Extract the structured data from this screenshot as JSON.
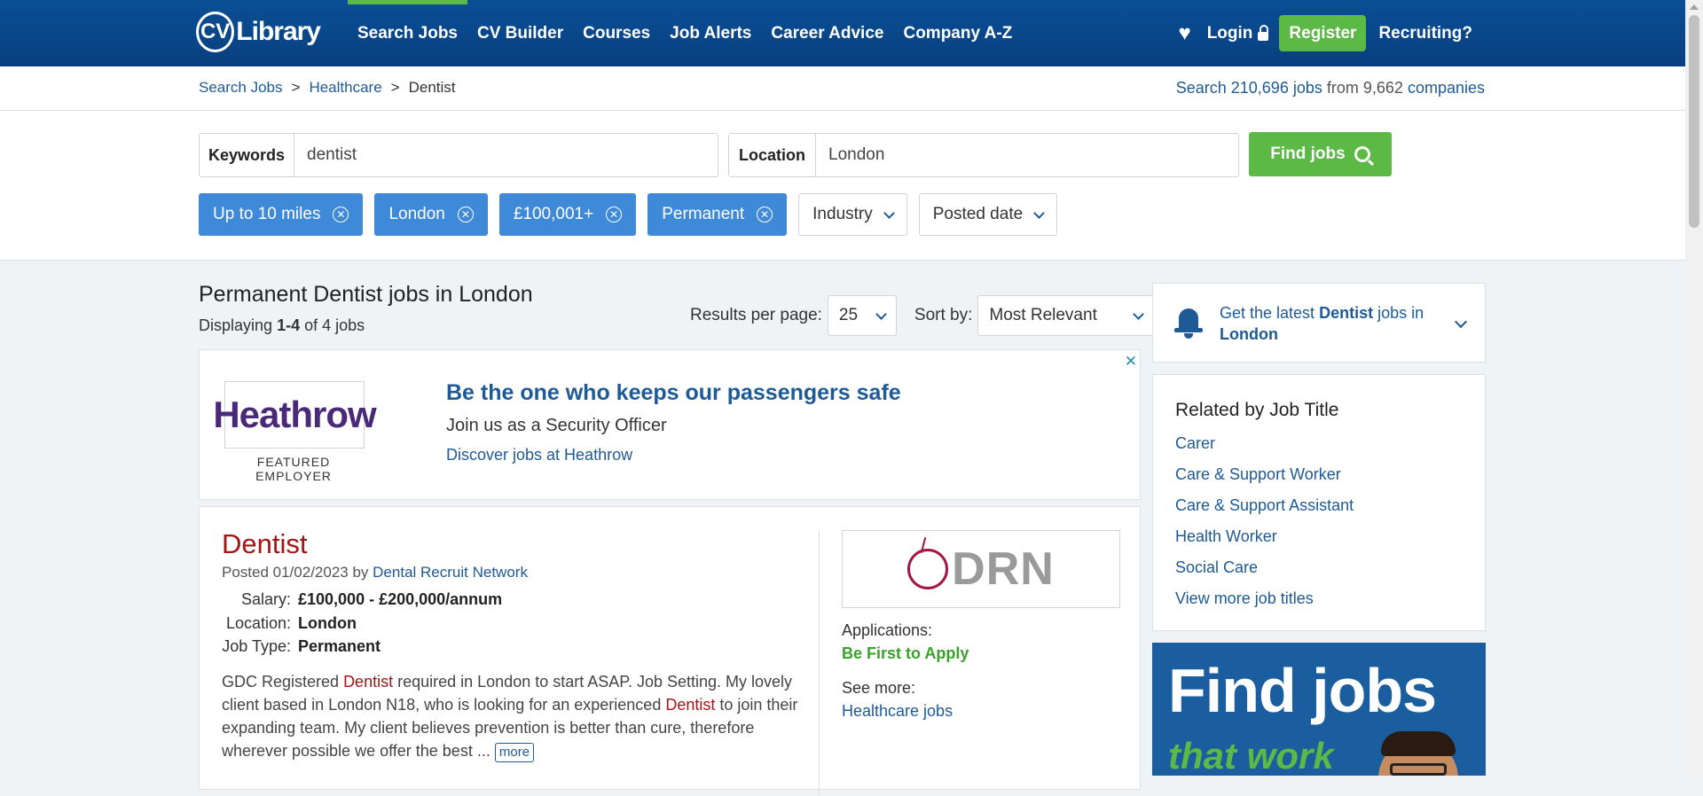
{
  "header": {
    "logo": {
      "cv": "CV",
      "library": "Library"
    },
    "nav": [
      {
        "label": "Search Jobs",
        "active": true
      },
      {
        "label": "CV Builder"
      },
      {
        "label": "Courses"
      },
      {
        "label": "Job Alerts"
      },
      {
        "label": "Career Advice"
      },
      {
        "label": "Company A-Z"
      }
    ],
    "login_label": "Login",
    "register_label": "Register",
    "recruiting_label": "Recruiting?"
  },
  "breadcrumb": {
    "items": [
      "Search Jobs",
      "Healthcare",
      "Dentist"
    ],
    "separator": ">"
  },
  "stats": {
    "prefix": "Search",
    "jobs": "210,696 jobs",
    "middle": "from",
    "companies_count": "9,662",
    "companies_label": "companies"
  },
  "search": {
    "keywords_label": "Keywords",
    "keywords_value": "dentist",
    "location_label": "Location",
    "location_value": "London",
    "find_label": "Find jobs"
  },
  "filters": {
    "chips": [
      "Up to 10 miles",
      "London",
      "£100,001+",
      "Permanent"
    ],
    "dropdowns": [
      "Industry",
      "Posted date"
    ]
  },
  "results": {
    "title": "Permanent Dentist jobs in London",
    "display_prefix": "Displaying",
    "display_range": "1-4",
    "display_suffix": "of 4 jobs",
    "per_page_label": "Results per page:",
    "per_page_value": "25",
    "sort_label": "Sort by:",
    "sort_value": "Most Relevant"
  },
  "ad": {
    "logo_text": "Heathrow",
    "logo_caption": "FEATURED EMPLOYER",
    "headline": "Be the one who keeps our passengers safe",
    "subline": "Join us as a Security Officer",
    "link": "Discover jobs at Heathrow",
    "close": "✕"
  },
  "job": {
    "title": "Dentist",
    "posted_prefix": "Posted 01/02/2023 by",
    "company": "Dental Recruit Network",
    "salary_label": "Salary:",
    "salary_value": "£100,000 - £200,000/annum",
    "location_label": "Location:",
    "location_value": "London",
    "type_label": "Job Type:",
    "type_value": "Permanent",
    "desc": [
      {
        "t": "GDC Registered "
      },
      {
        "t": "Dentist",
        "hl": true
      },
      {
        "t": " required in London to start ASAP. Job Setting. My lovely client based in London N18, who is looking for an experienced "
      },
      {
        "t": "Dentist",
        "hl": true
      },
      {
        "t": " to join their expanding team. My client believes prevention is better than cure, therefore wherever possible we offer the best "
      }
    ],
    "ellipsis": "...",
    "more_label": "more",
    "logo_text": "DRN",
    "applications_label": "Applications:",
    "applications_value": "Be First to Apply",
    "see_more_label": "See more:",
    "see_more_link": "Healthcare jobs"
  },
  "sidebar": {
    "alert_prefix": "Get the latest",
    "alert_keyword": "Dentist",
    "alert_middle": "jobs in",
    "alert_location": "London",
    "related_title": "Related by Job Title",
    "related_links": [
      "Carer",
      "Care & Support Worker",
      "Care & Support Assistant",
      "Health Worker",
      "Social Care",
      "View more job titles"
    ],
    "banner_line1": "Find jobs",
    "banner_line2": "that work"
  },
  "colors": {
    "header_blue": "#0a4f96",
    "accent_green": "#5cb946",
    "chip_blue": "#3f8ad8",
    "link_blue": "#1e5a96",
    "job_title_red": "#a31515"
  },
  "icons": [
    "heart-icon",
    "lock-icon",
    "search-icon",
    "close-icon",
    "chevron-down-icon",
    "bell-icon"
  ]
}
